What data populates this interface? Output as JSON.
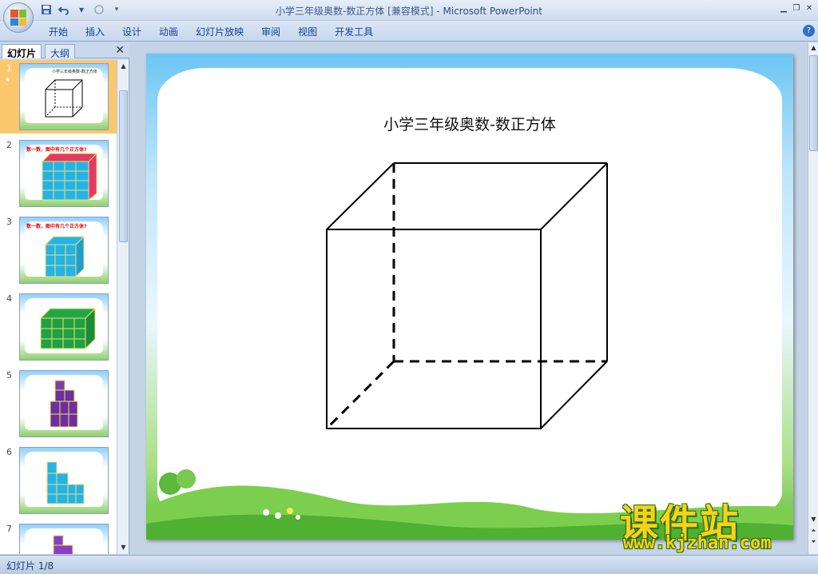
{
  "window": {
    "title": "小学三年级奥数-数正方体 [兼容模式]",
    "separator": " - ",
    "app_name": "Microsoft PowerPoint"
  },
  "ribbon": {
    "tabs": [
      "开始",
      "插入",
      "设计",
      "动画",
      "幻灯片放映",
      "审阅",
      "视图",
      "开发工具"
    ]
  },
  "left_pane": {
    "tabs": [
      "幻灯片",
      "大纲"
    ],
    "thumbnails": [
      {
        "num": "1",
        "title": "小学三年级奥数-数正方体"
      },
      {
        "num": "2",
        "title": "数一数，图中有几个正方体?"
      },
      {
        "num": "3",
        "title": "数一数，图中有几个正方体?"
      },
      {
        "num": "4",
        "title": ""
      },
      {
        "num": "5",
        "title": ""
      },
      {
        "num": "6",
        "title": ""
      },
      {
        "num": "7",
        "title": ""
      }
    ]
  },
  "slide": {
    "title": "小学三年级奥数-数正方体"
  },
  "watermark": {
    "title": "课件站",
    "url": "www.kjzhan.com"
  },
  "status": {
    "slide_counter": "幻灯片 1/8"
  },
  "colors": {
    "accent": "#15428b",
    "selected_thumb": "#fcc86e",
    "watermark": "#f6d21a"
  }
}
